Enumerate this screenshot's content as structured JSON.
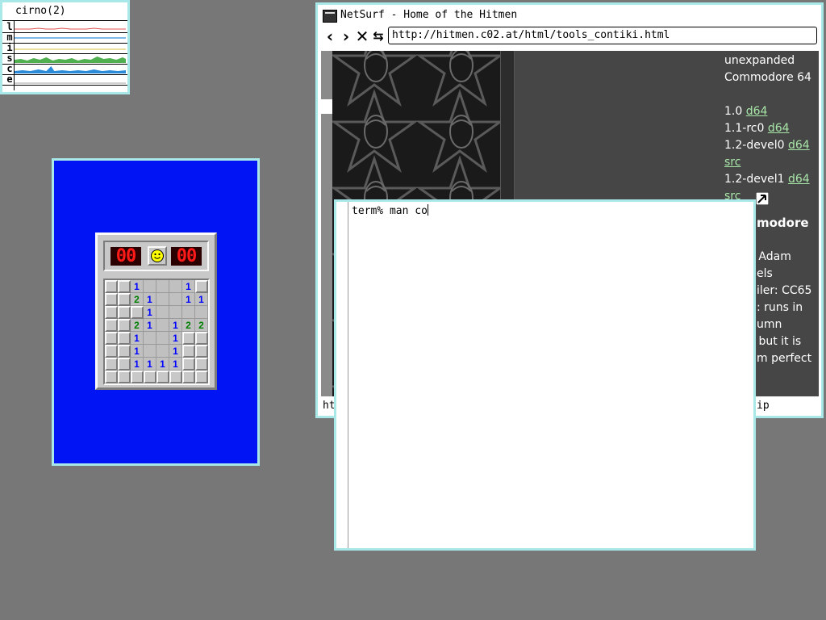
{
  "stats_window": {
    "title": "cirno(2)",
    "rows": [
      {
        "letter": "l",
        "color": "#e05050"
      },
      {
        "letter": "m",
        "color": "#50a0e0"
      },
      {
        "letter": "i",
        "color": "#d8c040"
      },
      {
        "letter": "s",
        "color": "#40a040"
      },
      {
        "letter": "c",
        "color": "#2080d0"
      },
      {
        "letter": "e",
        "color": "#a0a0a0"
      }
    ]
  },
  "minesweeper": {
    "mines_left": "00",
    "time": "00",
    "face": "smiley",
    "grid": [
      [
        "c",
        "c",
        "1",
        "",
        "",
        "",
        "1",
        "c"
      ],
      [
        "c",
        "c",
        "2",
        "1",
        "",
        "",
        "1",
        "1"
      ],
      [
        "c",
        "c",
        "c",
        "1",
        "",
        "",
        "",
        ""
      ],
      [
        "c",
        "c",
        "2",
        "1",
        "",
        "1",
        "2",
        "2"
      ],
      [
        "c",
        "c",
        "1",
        "",
        "",
        "1",
        "c",
        "c"
      ],
      [
        "c",
        "c",
        "1",
        "",
        "",
        "1",
        "c",
        "c"
      ],
      [
        "c",
        "c",
        "1",
        "1",
        "1",
        "1",
        "c",
        "c"
      ],
      [
        "c",
        "c",
        "c",
        "c",
        "c",
        "c",
        "c",
        "c"
      ]
    ]
  },
  "browser": {
    "title": "NetSurf - Home of the Hitmen",
    "url": "http://hitmen.c02.at/html/tools_contiki.html",
    "status_left": "ht",
    "status_right": "ip",
    "side_text": {
      "line1": "unexpanded",
      "line2": "Commodore 64",
      "v10": "1.0",
      "v10_link": "d64",
      "v11": "1.1-rc0",
      "v11_link": "d64",
      "v12d0": "1.2-devel0",
      "v12d0_link": "d64",
      "v12d0_src": "src",
      "v12d1": "1.2-devel1",
      "v12d1_link": "d64",
      "v12d1_src": "src",
      "heading": "modore",
      "by": "y: Adam",
      "els": "els",
      "compiler": "iler: CC65",
      "runs": ": runs in",
      "column": "umn",
      "butit": " but it is",
      "perfect": "m perfect"
    }
  },
  "terminal": {
    "prompt": "term%",
    "command": "man co"
  },
  "colors": {
    "desktop": "#777777",
    "border": "#a9e8e8",
    "minesweeper_bg": "#0014f4",
    "link": "#a8e6a8"
  }
}
